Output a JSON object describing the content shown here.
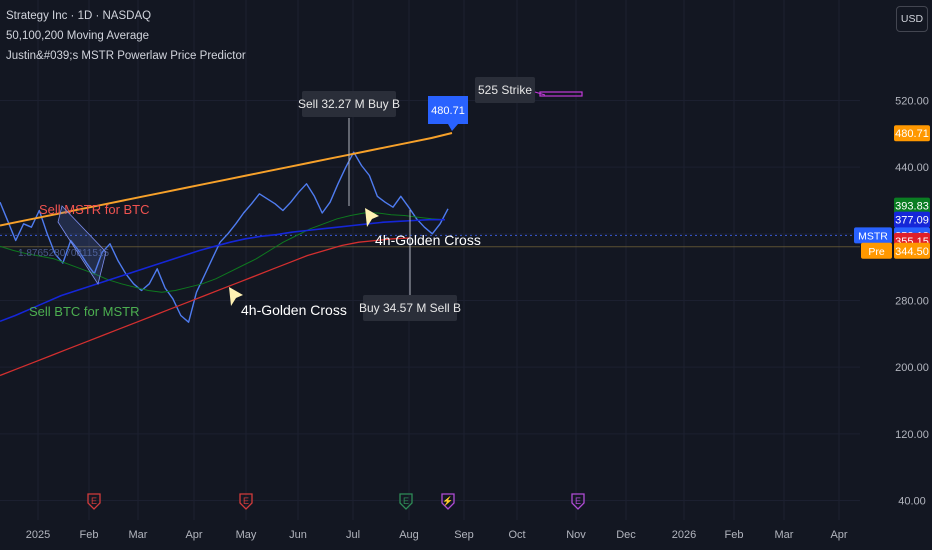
{
  "header": {
    "title": "Strategy Inc · 1D · NASDAQ",
    "indicator_1": "50,100,200 Moving Average",
    "indicator_2": "Justin&#039;s MSTR Powerlaw Price Predictor"
  },
  "currency_button": "USD",
  "chart_data": {
    "type": "line",
    "x_ticks": [
      "2025",
      "Feb",
      "Mar",
      "Apr",
      "May",
      "Jun",
      "Jul",
      "Aug",
      "Sep",
      "Oct",
      "Nov",
      "Dec",
      "2026",
      "Feb",
      "Mar",
      "Apr"
    ],
    "y_ticks": [
      40,
      120,
      200,
      280,
      360,
      440,
      520
    ],
    "ylim": [
      30,
      565
    ],
    "price_labels": [
      {
        "text": "480.71",
        "color": "#ff9800"
      },
      {
        "text": "393.83",
        "color": "#0a7d22"
      },
      {
        "text": "377.09",
        "color": "#1526d8"
      },
      {
        "text": "358.13",
        "color": "#2962ff",
        "tag": "MSTR"
      },
      {
        "text": "355.15",
        "color": "#e0202a"
      },
      {
        "text": "344.50",
        "color": "#ff9800",
        "tag": "Pre"
      }
    ],
    "series": [
      {
        "name": "MSTR",
        "color": "#4f7cf0",
        "values": [
          398,
          375,
          352,
          372,
          368,
          388,
          360,
          336,
          325,
          352,
          340,
          325,
          312,
          338,
          348,
          328,
          312,
          300,
          292,
          300,
          318,
          295,
          282,
          262,
          254,
          290,
          310,
          330,
          350,
          360,
          372,
          385,
          396,
          408,
          402,
          396,
          388,
          398,
          410,
          420,
          405,
          385,
          398,
          420,
          440,
          458,
          442,
          430,
          405,
          398,
          392,
          405,
          392,
          378,
          368,
          360,
          372,
          390
        ]
      },
      {
        "name": "",
        "color": "#0e7a1f",
        "values": [
          345,
          340,
          336,
          333,
          330,
          324,
          318,
          312,
          305,
          300,
          296,
          292,
          290,
          292,
          296,
          300,
          306,
          314,
          322,
          330,
          340,
          350,
          358,
          366,
          372,
          378,
          382,
          385,
          385,
          383,
          382,
          380,
          378,
          377
        ]
      },
      {
        "name": "",
        "color": "#1526d8",
        "values": [
          255,
          262,
          270,
          278,
          286,
          292,
          298,
          304,
          310,
          316,
          322,
          328,
          334,
          340,
          345,
          350,
          354,
          357,
          359,
          362,
          364,
          366,
          368,
          370,
          372,
          374,
          375,
          376,
          377,
          377
        ]
      },
      {
        "name": "",
        "color": "#d32f2f",
        "values": [
          190,
          198,
          206,
          214,
          222,
          230,
          238,
          246,
          254,
          262,
          270,
          278,
          286,
          294,
          302,
          310,
          318,
          326,
          334,
          340,
          346,
          350,
          352,
          354,
          355
        ]
      },
      {
        "name": "",
        "color": "#f7a12a",
        "values": [
          370,
          375,
          380,
          385,
          390,
          395,
          400,
          405,
          410,
          415,
          420,
          425,
          430,
          435,
          440,
          445,
          450,
          455,
          460,
          465,
          470,
          475,
          481
        ]
      }
    ],
    "annotations": [
      {
        "id": "sell-buy",
        "text": "Sell 32.27 M Buy B"
      },
      {
        "id": "buy-sell",
        "text": "Buy 34.57 M Sell B"
      },
      {
        "id": "strike",
        "text": "525 Strike"
      },
      {
        "id": "price-flag",
        "text": "480.71"
      },
      {
        "id": "sell-mstr",
        "text": "Sell MSTR for BTC",
        "color": "#ef5350"
      },
      {
        "id": "sell-btc",
        "text": "Sell BTC for MSTR",
        "color": "#4caf50"
      },
      {
        "id": "golden-1",
        "text": "4h-Golden Cross"
      },
      {
        "id": "golden-2",
        "text": "4h-Golden Cross"
      },
      {
        "id": "faint-num",
        "text": "1.876528070811515"
      }
    ],
    "event_markers": [
      "E",
      "E",
      "E",
      "⚡",
      "E"
    ]
  }
}
